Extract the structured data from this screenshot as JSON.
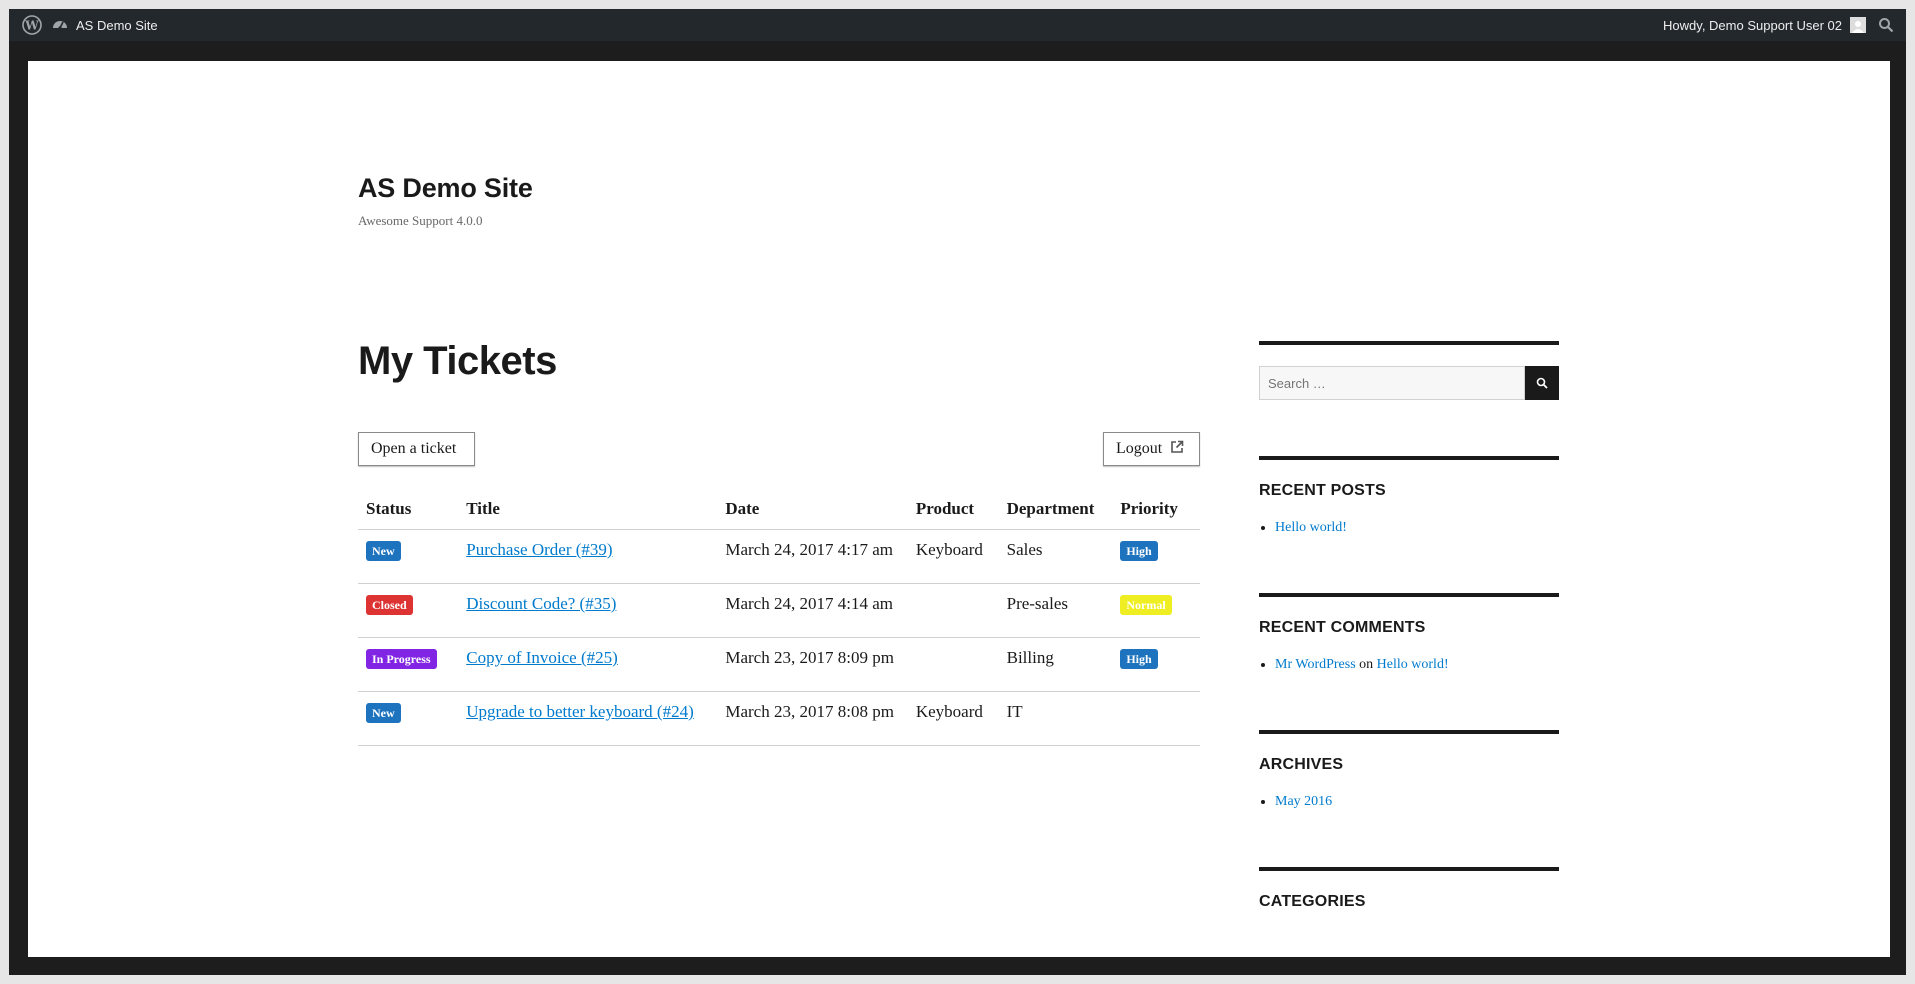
{
  "admin_bar": {
    "site_name": "AS Demo Site",
    "greeting": "Howdy, Demo Support User 02"
  },
  "header": {
    "site_title": "AS Demo Site",
    "tagline": "Awesome Support 4.0.0"
  },
  "main": {
    "heading": "My Tickets",
    "open_ticket_label": "Open a ticket",
    "logout_label": "Logout"
  },
  "table": {
    "columns": [
      "Status",
      "Title",
      "Date",
      "Product",
      "Department",
      "Priority"
    ],
    "rows": [
      {
        "status": "New",
        "status_color": "#1e73be",
        "title": "Purchase Order (#39)",
        "date": "March 24, 2017 4:17 am",
        "product": "Keyboard",
        "department": "Sales",
        "priority": "High",
        "priority_color": "#1e73be",
        "priority_text_color": "#ffffff"
      },
      {
        "status": "Closed",
        "status_color": "#dd3333",
        "title": "Discount Code? (#35)",
        "date": "March 24, 2017 4:14 am",
        "product": "",
        "department": "Pre-sales",
        "priority": "Normal",
        "priority_color": "#eeee22",
        "priority_text_color": "#ffffff"
      },
      {
        "status": "In Progress",
        "status_color": "#8224e3",
        "title": "Copy of Invoice (#25)",
        "date": "March 23, 2017 8:09 pm",
        "product": "",
        "department": "Billing",
        "priority": "High",
        "priority_color": "#1e73be",
        "priority_text_color": "#ffffff"
      },
      {
        "status": "New",
        "status_color": "#1e73be",
        "title": "Upgrade to better keyboard (#24)",
        "date": "March 23, 2017 8:08 pm",
        "product": "Keyboard",
        "department": "IT",
        "priority": "",
        "priority_color": "",
        "priority_text_color": ""
      }
    ]
  },
  "sidebar": {
    "search_placeholder": "Search …",
    "recent_posts": {
      "title": "RECENT POSTS",
      "items": [
        "Hello world!"
      ]
    },
    "recent_comments": {
      "title": "RECENT COMMENTS",
      "author": "Mr WordPress",
      "connector": "on",
      "post": "Hello world!"
    },
    "archives": {
      "title": "ARCHIVES",
      "items": [
        "May 2016"
      ]
    },
    "categories": {
      "title": "CATEGORIES"
    }
  },
  "colors": {
    "link": "#007acc",
    "admin_bar": "#23282d"
  }
}
